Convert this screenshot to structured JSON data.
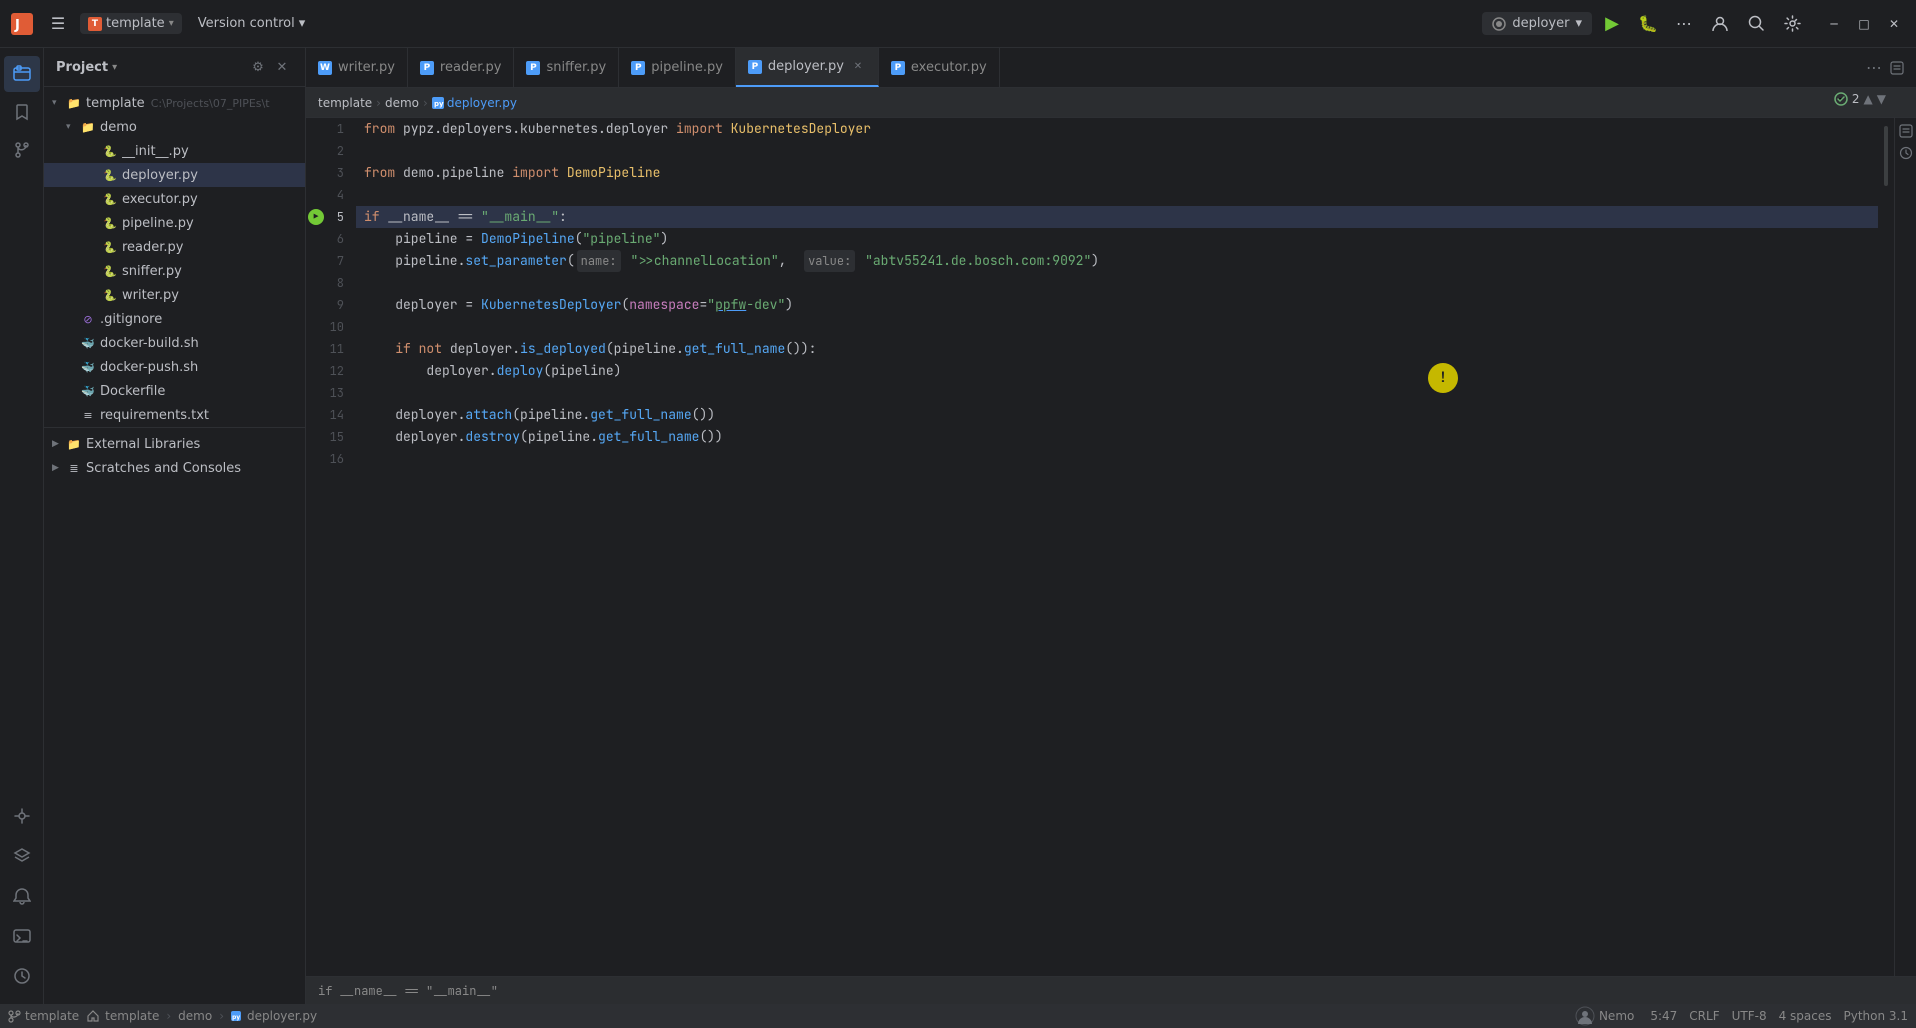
{
  "app": {
    "title": "template",
    "logo_letter": "T",
    "logo_color": "#e05c36"
  },
  "titlebar": {
    "hamburger_label": "☰",
    "project_name": "template",
    "project_chevron": "▾",
    "vcs_label": "Version control",
    "vcs_chevron": "▾",
    "deployer_label": "deployer",
    "deployer_chevron": "▾",
    "run_icon": "▶",
    "coverage_icon": "🐛",
    "more_icon": "⋯",
    "user_icon": "👤",
    "search_icon": "🔍",
    "settings_icon": "⚙",
    "minimize": "─",
    "maximize": "□",
    "close": "✕"
  },
  "project_panel": {
    "title": "Project",
    "chevron": "▾",
    "root": {
      "name": "template",
      "path": "C:\\Projects\\07_PIPEs\\t"
    },
    "tree": [
      {
        "id": "template-root",
        "label": "template",
        "type": "folder",
        "level": 0,
        "expanded": true
      },
      {
        "id": "demo-folder",
        "label": "demo",
        "type": "folder",
        "level": 1,
        "expanded": true
      },
      {
        "id": "init-py",
        "label": "__init__.py",
        "type": "py",
        "level": 2
      },
      {
        "id": "deployer-py",
        "label": "deployer.py",
        "type": "py",
        "level": 2,
        "active": true
      },
      {
        "id": "executor-py",
        "label": "executor.py",
        "type": "py",
        "level": 2
      },
      {
        "id": "pipeline-py",
        "label": "pipeline.py",
        "type": "py",
        "level": 2
      },
      {
        "id": "reader-py",
        "label": "reader.py",
        "type": "py",
        "level": 2
      },
      {
        "id": "sniffer-py",
        "label": "sniffer.py",
        "type": "py",
        "level": 2
      },
      {
        "id": "writer-py",
        "label": "writer.py",
        "type": "py",
        "level": 2
      },
      {
        "id": "gitignore",
        "label": ".gitignore",
        "type": "git",
        "level": 1
      },
      {
        "id": "docker-build",
        "label": "docker-build.sh",
        "type": "docker",
        "level": 1
      },
      {
        "id": "docker-push",
        "label": "docker-push.sh",
        "type": "docker",
        "level": 1
      },
      {
        "id": "dockerfile",
        "label": "Dockerfile",
        "type": "docker",
        "level": 1
      },
      {
        "id": "requirements",
        "label": "requirements.txt",
        "type": "text",
        "level": 1
      }
    ],
    "external_libraries": {
      "label": "External Libraries",
      "level": 0
    },
    "scratches": {
      "label": "Scratches and Consoles",
      "level": 0
    }
  },
  "tabs": [
    {
      "id": "writer",
      "label": "writer.py",
      "color": "#4d9cf8",
      "active": false,
      "closeable": false
    },
    {
      "id": "reader",
      "label": "reader.py",
      "color": "#4d9cf8",
      "active": false,
      "closeable": false
    },
    {
      "id": "sniffer",
      "label": "sniffer.py",
      "color": "#4d9cf8",
      "active": false,
      "closeable": false
    },
    {
      "id": "pipeline",
      "label": "pipeline.py",
      "color": "#4d9cf8",
      "active": false,
      "closeable": false
    },
    {
      "id": "deployer",
      "label": "deployer.py",
      "color": "#4d9cf8",
      "active": true,
      "closeable": true
    },
    {
      "id": "executor",
      "label": "executor.py",
      "color": "#4d9cf8",
      "active": false,
      "closeable": false
    }
  ],
  "editor": {
    "filename": "deployer.py",
    "errors_count": "2",
    "breadcrumb": [
      "template",
      "demo",
      "deployer.py"
    ],
    "breadcrumb_sep": ">",
    "code_lines": [
      {
        "num": 1,
        "content": "from pypz.deployers.kubernetes.deployer import KubernetesDeployer",
        "run": false
      },
      {
        "num": 2,
        "content": "",
        "run": false
      },
      {
        "num": 3,
        "content": "from demo.pipeline import DemoPipeline",
        "run": false
      },
      {
        "num": 4,
        "content": "",
        "run": false
      },
      {
        "num": 5,
        "content": "if __name__ == \"__main__\":",
        "run": true
      },
      {
        "num": 6,
        "content": "    pipeline = DemoPipeline(\"pipeline\")",
        "run": false
      },
      {
        "num": 7,
        "content": "    pipeline.set_parameter( name: \">>channelLocation\",  value: \"abtv55241.de.bosch.com:9092\")",
        "run": false
      },
      {
        "num": 8,
        "content": "",
        "run": false
      },
      {
        "num": 9,
        "content": "    deployer = KubernetesDeployer(namespace=\"ppfw-dev\")",
        "run": false
      },
      {
        "num": 10,
        "content": "",
        "run": false
      },
      {
        "num": 11,
        "content": "    if not deployer.is_deployed(pipeline.get_full_name()):",
        "run": false
      },
      {
        "num": 12,
        "content": "        deployer.deploy(pipeline)",
        "run": false
      },
      {
        "num": 13,
        "content": "",
        "run": false
      },
      {
        "num": 14,
        "content": "    deployer.attach(pipeline.get_full_name())",
        "run": false
      },
      {
        "num": 15,
        "content": "    deployer.destroy(pipeline.get_full_name())",
        "run": false
      },
      {
        "num": 16,
        "content": "",
        "run": false
      }
    ]
  },
  "statusbar": {
    "branch_icon": "⎇",
    "branch_name": "template",
    "breadcrumb_demo": "demo",
    "breadcrumb_sep": ">",
    "breadcrumb_file": "deployer.py",
    "nemo": "Nemo",
    "position": "5:47",
    "line_sep": "CRLF",
    "encoding": "UTF-8",
    "indent": "4 spaces",
    "language": "Python 3.1"
  },
  "bottom_bar": {
    "status_text": "if __name__ == \"__main__\""
  }
}
